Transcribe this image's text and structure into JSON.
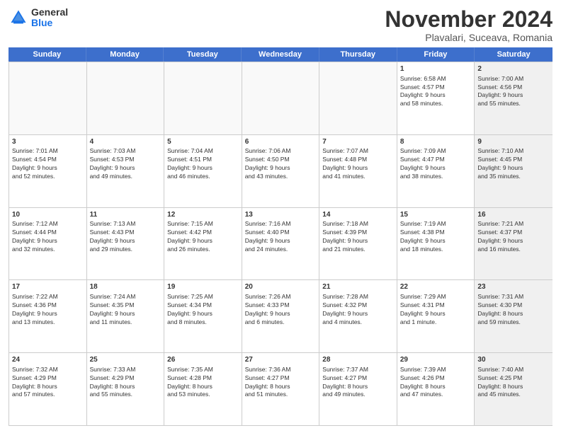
{
  "logo": {
    "general": "General",
    "blue": "Blue"
  },
  "title": "November 2024",
  "subtitle": "Plavalari, Suceava, Romania",
  "header_days": [
    "Sunday",
    "Monday",
    "Tuesday",
    "Wednesday",
    "Thursday",
    "Friday",
    "Saturday"
  ],
  "weeks": [
    [
      {
        "day": "",
        "info": "",
        "shaded": false,
        "empty": true
      },
      {
        "day": "",
        "info": "",
        "shaded": false,
        "empty": true
      },
      {
        "day": "",
        "info": "",
        "shaded": false,
        "empty": true
      },
      {
        "day": "",
        "info": "",
        "shaded": false,
        "empty": true
      },
      {
        "day": "",
        "info": "",
        "shaded": false,
        "empty": true
      },
      {
        "day": "1",
        "info": "Sunrise: 6:58 AM\nSunset: 4:57 PM\nDaylight: 9 hours\nand 58 minutes.",
        "shaded": false,
        "empty": false
      },
      {
        "day": "2",
        "info": "Sunrise: 7:00 AM\nSunset: 4:56 PM\nDaylight: 9 hours\nand 55 minutes.",
        "shaded": true,
        "empty": false
      }
    ],
    [
      {
        "day": "3",
        "info": "Sunrise: 7:01 AM\nSunset: 4:54 PM\nDaylight: 9 hours\nand 52 minutes.",
        "shaded": false,
        "empty": false
      },
      {
        "day": "4",
        "info": "Sunrise: 7:03 AM\nSunset: 4:53 PM\nDaylight: 9 hours\nand 49 minutes.",
        "shaded": false,
        "empty": false
      },
      {
        "day": "5",
        "info": "Sunrise: 7:04 AM\nSunset: 4:51 PM\nDaylight: 9 hours\nand 46 minutes.",
        "shaded": false,
        "empty": false
      },
      {
        "day": "6",
        "info": "Sunrise: 7:06 AM\nSunset: 4:50 PM\nDaylight: 9 hours\nand 43 minutes.",
        "shaded": false,
        "empty": false
      },
      {
        "day": "7",
        "info": "Sunrise: 7:07 AM\nSunset: 4:48 PM\nDaylight: 9 hours\nand 41 minutes.",
        "shaded": false,
        "empty": false
      },
      {
        "day": "8",
        "info": "Sunrise: 7:09 AM\nSunset: 4:47 PM\nDaylight: 9 hours\nand 38 minutes.",
        "shaded": false,
        "empty": false
      },
      {
        "day": "9",
        "info": "Sunrise: 7:10 AM\nSunset: 4:45 PM\nDaylight: 9 hours\nand 35 minutes.",
        "shaded": true,
        "empty": false
      }
    ],
    [
      {
        "day": "10",
        "info": "Sunrise: 7:12 AM\nSunset: 4:44 PM\nDaylight: 9 hours\nand 32 minutes.",
        "shaded": false,
        "empty": false
      },
      {
        "day": "11",
        "info": "Sunrise: 7:13 AM\nSunset: 4:43 PM\nDaylight: 9 hours\nand 29 minutes.",
        "shaded": false,
        "empty": false
      },
      {
        "day": "12",
        "info": "Sunrise: 7:15 AM\nSunset: 4:42 PM\nDaylight: 9 hours\nand 26 minutes.",
        "shaded": false,
        "empty": false
      },
      {
        "day": "13",
        "info": "Sunrise: 7:16 AM\nSunset: 4:40 PM\nDaylight: 9 hours\nand 24 minutes.",
        "shaded": false,
        "empty": false
      },
      {
        "day": "14",
        "info": "Sunrise: 7:18 AM\nSunset: 4:39 PM\nDaylight: 9 hours\nand 21 minutes.",
        "shaded": false,
        "empty": false
      },
      {
        "day": "15",
        "info": "Sunrise: 7:19 AM\nSunset: 4:38 PM\nDaylight: 9 hours\nand 18 minutes.",
        "shaded": false,
        "empty": false
      },
      {
        "day": "16",
        "info": "Sunrise: 7:21 AM\nSunset: 4:37 PM\nDaylight: 9 hours\nand 16 minutes.",
        "shaded": true,
        "empty": false
      }
    ],
    [
      {
        "day": "17",
        "info": "Sunrise: 7:22 AM\nSunset: 4:36 PM\nDaylight: 9 hours\nand 13 minutes.",
        "shaded": false,
        "empty": false
      },
      {
        "day": "18",
        "info": "Sunrise: 7:24 AM\nSunset: 4:35 PM\nDaylight: 9 hours\nand 11 minutes.",
        "shaded": false,
        "empty": false
      },
      {
        "day": "19",
        "info": "Sunrise: 7:25 AM\nSunset: 4:34 PM\nDaylight: 9 hours\nand 8 minutes.",
        "shaded": false,
        "empty": false
      },
      {
        "day": "20",
        "info": "Sunrise: 7:26 AM\nSunset: 4:33 PM\nDaylight: 9 hours\nand 6 minutes.",
        "shaded": false,
        "empty": false
      },
      {
        "day": "21",
        "info": "Sunrise: 7:28 AM\nSunset: 4:32 PM\nDaylight: 9 hours\nand 4 minutes.",
        "shaded": false,
        "empty": false
      },
      {
        "day": "22",
        "info": "Sunrise: 7:29 AM\nSunset: 4:31 PM\nDaylight: 9 hours\nand 1 minute.",
        "shaded": false,
        "empty": false
      },
      {
        "day": "23",
        "info": "Sunrise: 7:31 AM\nSunset: 4:30 PM\nDaylight: 8 hours\nand 59 minutes.",
        "shaded": true,
        "empty": false
      }
    ],
    [
      {
        "day": "24",
        "info": "Sunrise: 7:32 AM\nSunset: 4:29 PM\nDaylight: 8 hours\nand 57 minutes.",
        "shaded": false,
        "empty": false
      },
      {
        "day": "25",
        "info": "Sunrise: 7:33 AM\nSunset: 4:29 PM\nDaylight: 8 hours\nand 55 minutes.",
        "shaded": false,
        "empty": false
      },
      {
        "day": "26",
        "info": "Sunrise: 7:35 AM\nSunset: 4:28 PM\nDaylight: 8 hours\nand 53 minutes.",
        "shaded": false,
        "empty": false
      },
      {
        "day": "27",
        "info": "Sunrise: 7:36 AM\nSunset: 4:27 PM\nDaylight: 8 hours\nand 51 minutes.",
        "shaded": false,
        "empty": false
      },
      {
        "day": "28",
        "info": "Sunrise: 7:37 AM\nSunset: 4:27 PM\nDaylight: 8 hours\nand 49 minutes.",
        "shaded": false,
        "empty": false
      },
      {
        "day": "29",
        "info": "Sunrise: 7:39 AM\nSunset: 4:26 PM\nDaylight: 8 hours\nand 47 minutes.",
        "shaded": false,
        "empty": false
      },
      {
        "day": "30",
        "info": "Sunrise: 7:40 AM\nSunset: 4:25 PM\nDaylight: 8 hours\nand 45 minutes.",
        "shaded": true,
        "empty": false
      }
    ]
  ]
}
